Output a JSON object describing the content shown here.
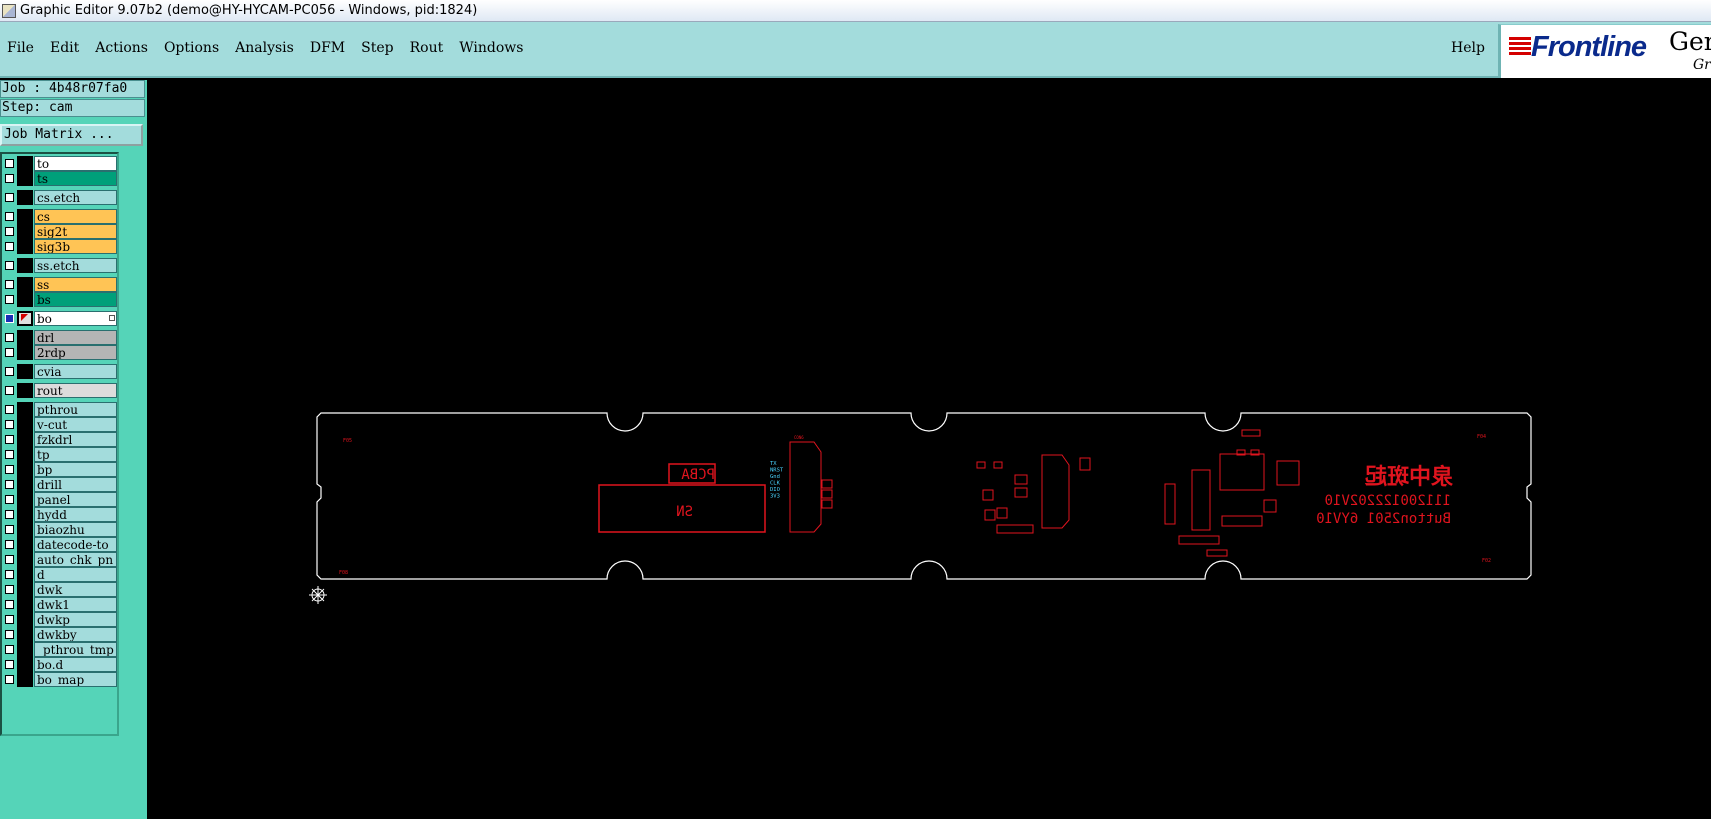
{
  "window": {
    "title": "Graphic Editor 9.07b2 (demo@HY-HYCAM-PC056 - Windows, pid:1824)"
  },
  "menu": {
    "items": [
      "File",
      "Edit",
      "Actions",
      "Options",
      "Analysis",
      "DFM",
      "Step",
      "Rout",
      "Windows"
    ],
    "help": "Help"
  },
  "logo": {
    "word": "Frontline",
    "product": "Gen",
    "sub": "Gro"
  },
  "job": {
    "label": "Job : 4b48r07fa0",
    "step": "Step: cam",
    "matrix_button": "Job Matrix ..."
  },
  "layers": [
    {
      "name": "to",
      "color": "#ffffff"
    },
    {
      "name": "ts",
      "color": "#00a07a"
    },
    {
      "name": "cs.etch",
      "color": "#a3dcdc"
    },
    {
      "name": "cs",
      "color": "#ffc455"
    },
    {
      "name": "sig2t",
      "color": "#ffc455"
    },
    {
      "name": "sig3b",
      "color": "#ffc455"
    },
    {
      "name": "ss.etch",
      "color": "#a3dcdc"
    },
    {
      "name": "ss",
      "color": "#ffc455"
    },
    {
      "name": "bs",
      "color": "#00a07a"
    },
    {
      "name": "bo",
      "color": "#ffffff",
      "active": true
    },
    {
      "name": "drl",
      "color": "#b5b5b5"
    },
    {
      "name": "2rdp",
      "color": "#b5b5b5"
    },
    {
      "name": "cvia",
      "color": "#a3dcdc"
    },
    {
      "name": "rout",
      "color": "#dcdcdc"
    },
    {
      "name": "pthrou",
      "color": "#a3dcdc"
    },
    {
      "name": "v-cut",
      "color": "#a3dcdc"
    },
    {
      "name": "fzkdrl",
      "color": "#a3dcdc"
    },
    {
      "name": "tp",
      "color": "#a3dcdc"
    },
    {
      "name": "bp",
      "color": "#a3dcdc"
    },
    {
      "name": "drill",
      "color": "#a3dcdc"
    },
    {
      "name": "panel",
      "color": "#a3dcdc"
    },
    {
      "name": "hydd",
      "color": "#a3dcdc"
    },
    {
      "name": "biaozhu",
      "color": "#a3dcdc"
    },
    {
      "name": "datecode-to",
      "color": "#a3dcdc"
    },
    {
      "name": "auto_chk_pn",
      "color": "#a3dcdc"
    },
    {
      "name": "d",
      "color": "#a3dcdc"
    },
    {
      "name": "dwk",
      "color": "#a3dcdc"
    },
    {
      "name": "dwk1",
      "color": "#a3dcdc"
    },
    {
      "name": "dwkp",
      "color": "#a3dcdc"
    },
    {
      "name": "dwkby",
      "color": "#a3dcdc"
    },
    {
      "name": "_pthrou_tmp",
      "color": "#a3dcdc"
    },
    {
      "name": "bo.d",
      "color": "#a3dcdc"
    },
    {
      "name": "bo_map",
      "color": "#a3dcdc"
    }
  ],
  "board": {
    "pcba_label": "PCBA",
    "sn_label": "SN",
    "pin_labels": [
      "TX",
      "NRST",
      "Gnd",
      "CLK",
      "DIO",
      "3V3"
    ],
    "chinese_text": "泉中斑起",
    "code_line_1": "111200122202V10",
    "code_line_2": "Button2501 6YV10",
    "fiducials": [
      "F05",
      "F04",
      "F08",
      "F02"
    ],
    "colors": {
      "outline": "#ffffff",
      "silk": "#e0141e",
      "pins": "#4ad4ff"
    }
  }
}
